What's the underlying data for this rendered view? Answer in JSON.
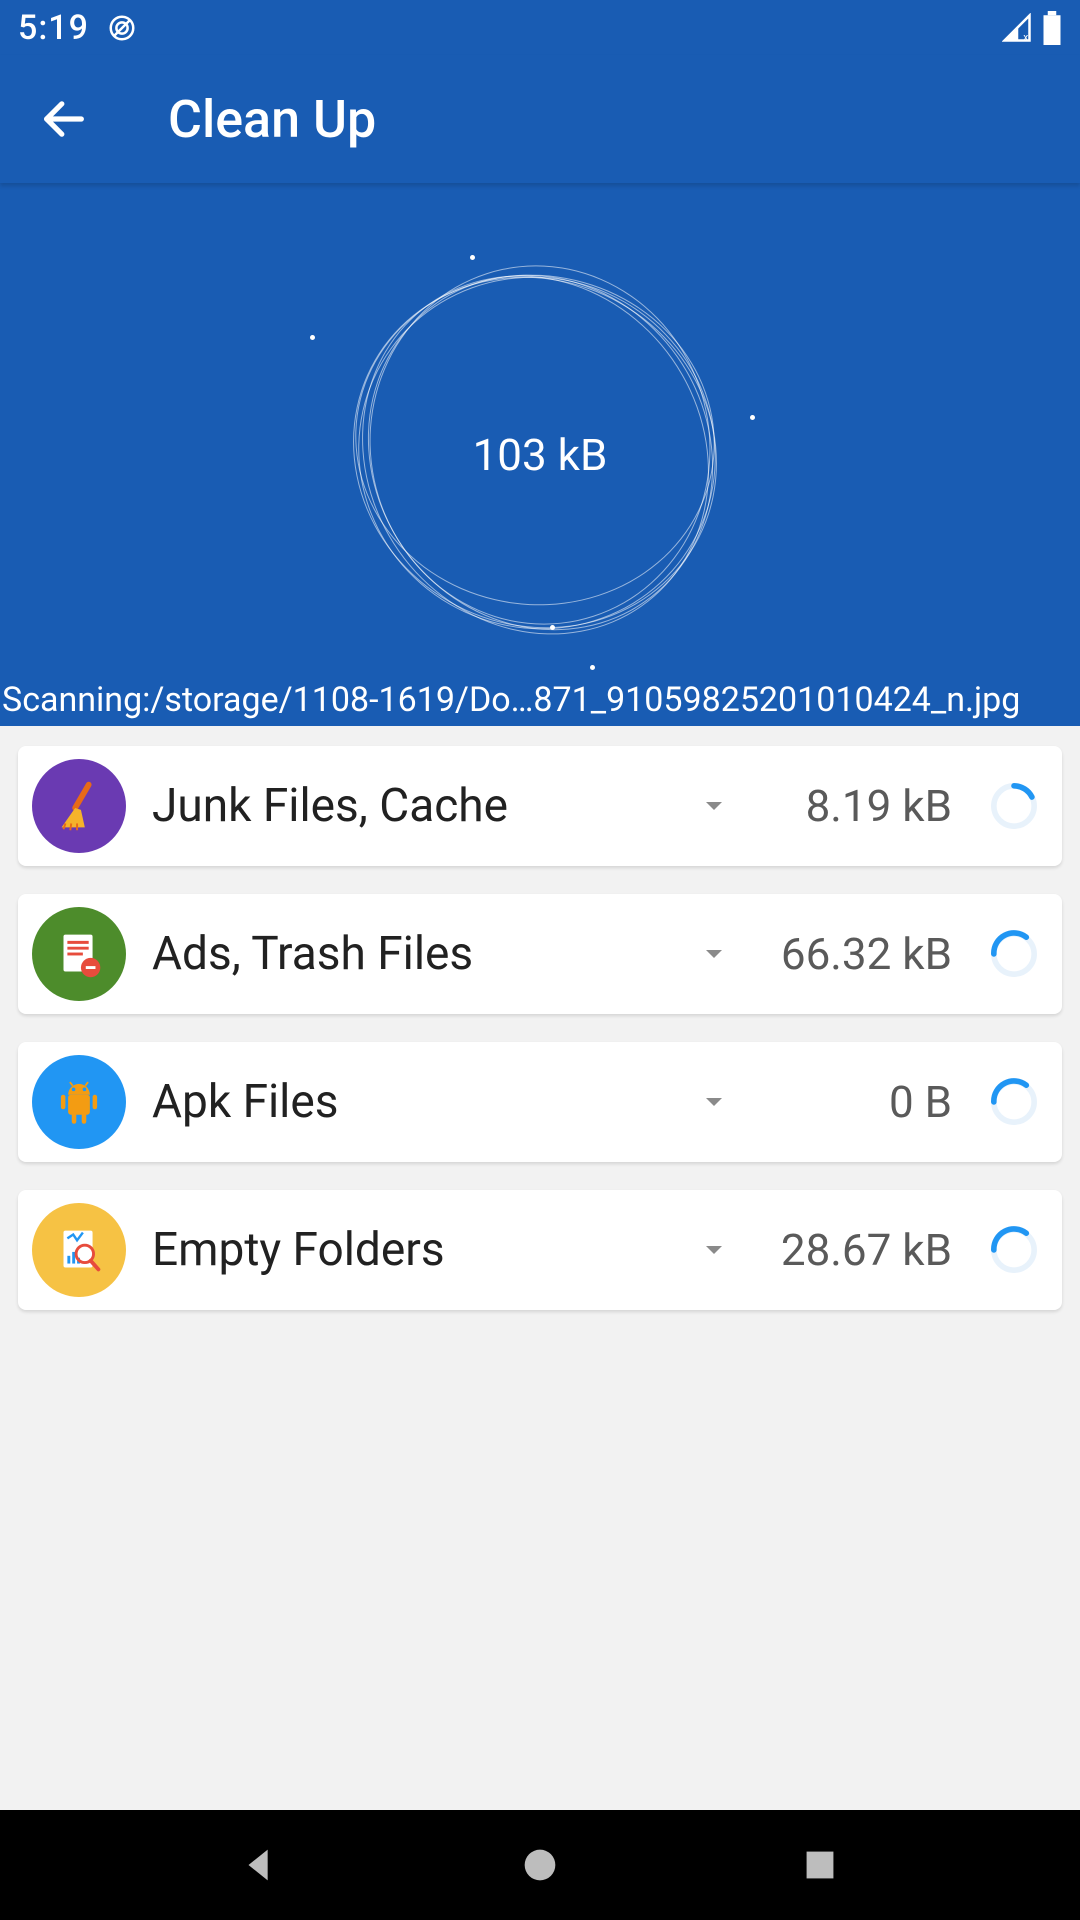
{
  "status_bar": {
    "time": "5:19"
  },
  "app_bar": {
    "title": "Clean Up"
  },
  "hero": {
    "total_size": "103 kB",
    "scanning_text": "Scanning:/storage/1108-1619/Do…871_91059825201010424_n.jpg"
  },
  "categories": [
    {
      "id": "junk",
      "label": "Junk Files, Cache",
      "size": "8.19 kB",
      "icon_bg": "#6A3AB2",
      "icon": "broom"
    },
    {
      "id": "ads",
      "label": "Ads, Trash Files",
      "size": "66.32 kB",
      "icon_bg": "#4D8C2B",
      "icon": "doc-remove"
    },
    {
      "id": "apk",
      "label": "Apk Files",
      "size": "0 B",
      "icon_bg": "#2196F3",
      "icon": "android"
    },
    {
      "id": "empty",
      "label": "Empty Folders",
      "size": "28.67 kB",
      "icon_bg": "#F6C244",
      "icon": "doc-search"
    }
  ],
  "nav": {
    "back": "back",
    "home": "home",
    "recent": "recent"
  }
}
